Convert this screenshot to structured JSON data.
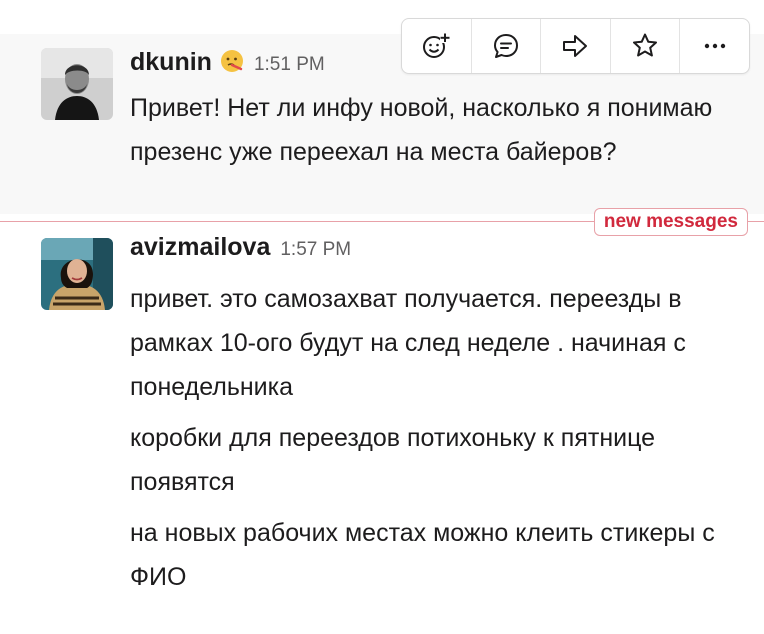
{
  "messages": [
    {
      "author": "dkunin",
      "status_emoji": "face-with-thermometer-emoji",
      "time": "1:51 PM",
      "paragraphs": [
        "Привет! Нет ли инфу новой, насколько я понимаю презенс уже переехал на места байеров?"
      ]
    },
    {
      "author": "avizmailova",
      "time": "1:57 PM",
      "paragraphs": [
        "привет. это самозахват получается. переезды в рамках 10-ого будут на след неделе . начиная с понедельника",
        "коробки для переездов потихоньку к пятнице появятся",
        "на новых рабочих местах можно клеить стикеры с ФИО"
      ]
    }
  ],
  "divider": {
    "label": "new messages",
    "color": "#d1293d"
  },
  "message_actions": [
    "add-reaction-icon",
    "reply-in-thread-icon",
    "share-message-icon",
    "save-star-icon",
    "more-actions-icon"
  ]
}
